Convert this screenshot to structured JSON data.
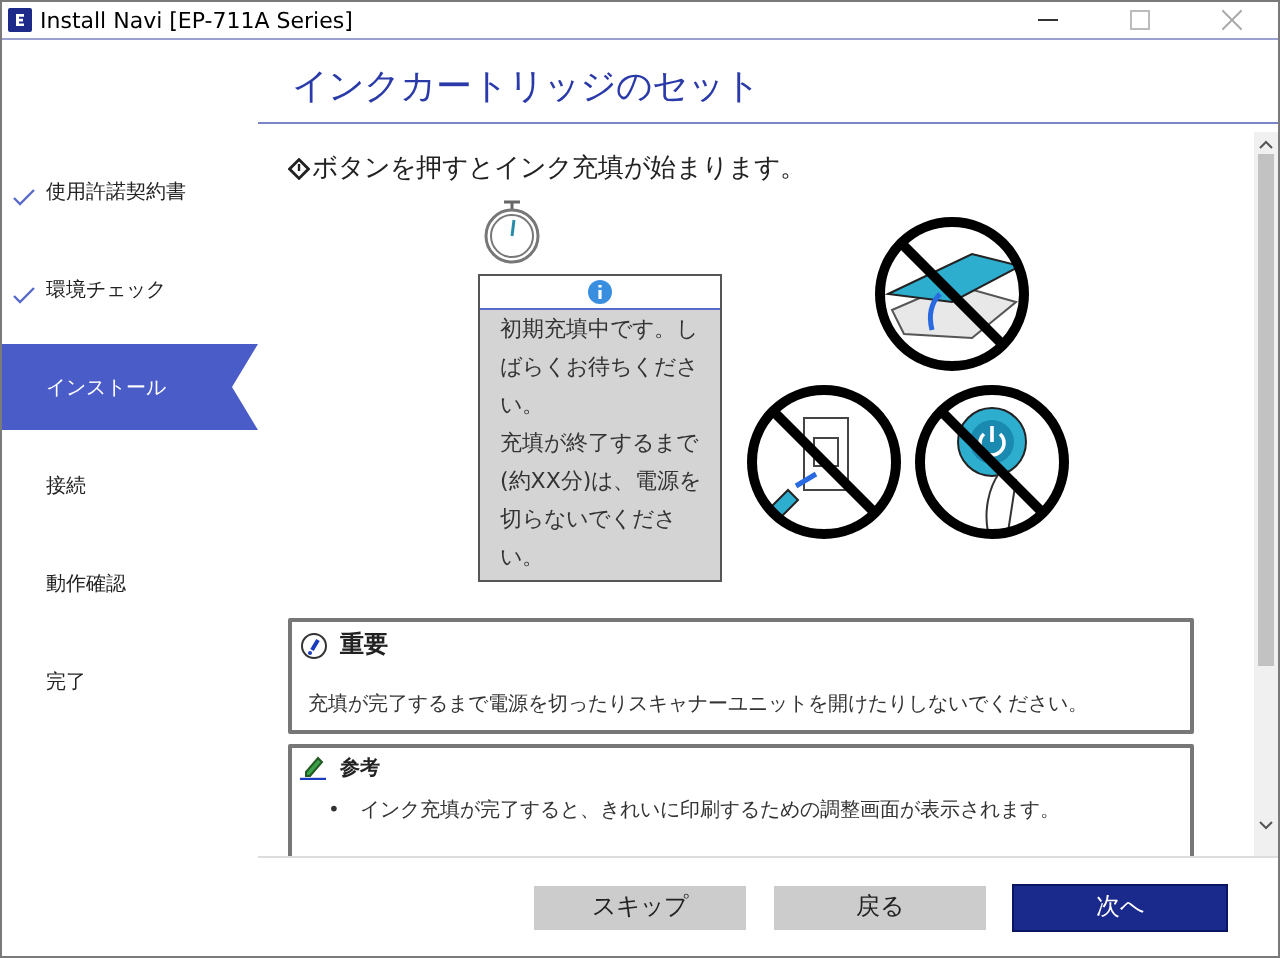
{
  "window": {
    "title": "Install Navi [EP-711A Series]"
  },
  "steps": [
    {
      "label": "使用許諾契約書",
      "checked": true,
      "selected": false
    },
    {
      "label": "環境チェック",
      "checked": true,
      "selected": false
    },
    {
      "label": "インストール",
      "checked": false,
      "selected": true
    },
    {
      "label": "接続",
      "checked": false,
      "selected": false
    },
    {
      "label": "動作確認",
      "checked": false,
      "selected": false
    },
    {
      "label": "完了",
      "checked": false,
      "selected": false
    }
  ],
  "page_title": "インクカートリッジのセット",
  "instruction": "ボタンを押すとインク充填が始まります。",
  "info_box": {
    "paragraphs": [
      "初期充填中です。しばらくお待ちください。",
      "充填が終了するまで(約XX分)は、電源を切らないでください。"
    ]
  },
  "important": {
    "heading": "重要",
    "text": "充填が完了するまで電源を切ったりスキャナーユニットを開けたりしないでください。"
  },
  "note": {
    "heading": "参考",
    "items": [
      {
        "bullet": "•",
        "text": "インク充填が完了すると、きれいに印刷するための調整画面が表示されます。"
      }
    ]
  },
  "buttons": [
    {
      "label": "スキップ",
      "kind": "secondary"
    },
    {
      "label": "戻る",
      "kind": "secondary"
    },
    {
      "label": "次へ",
      "kind": "primary"
    }
  ]
}
